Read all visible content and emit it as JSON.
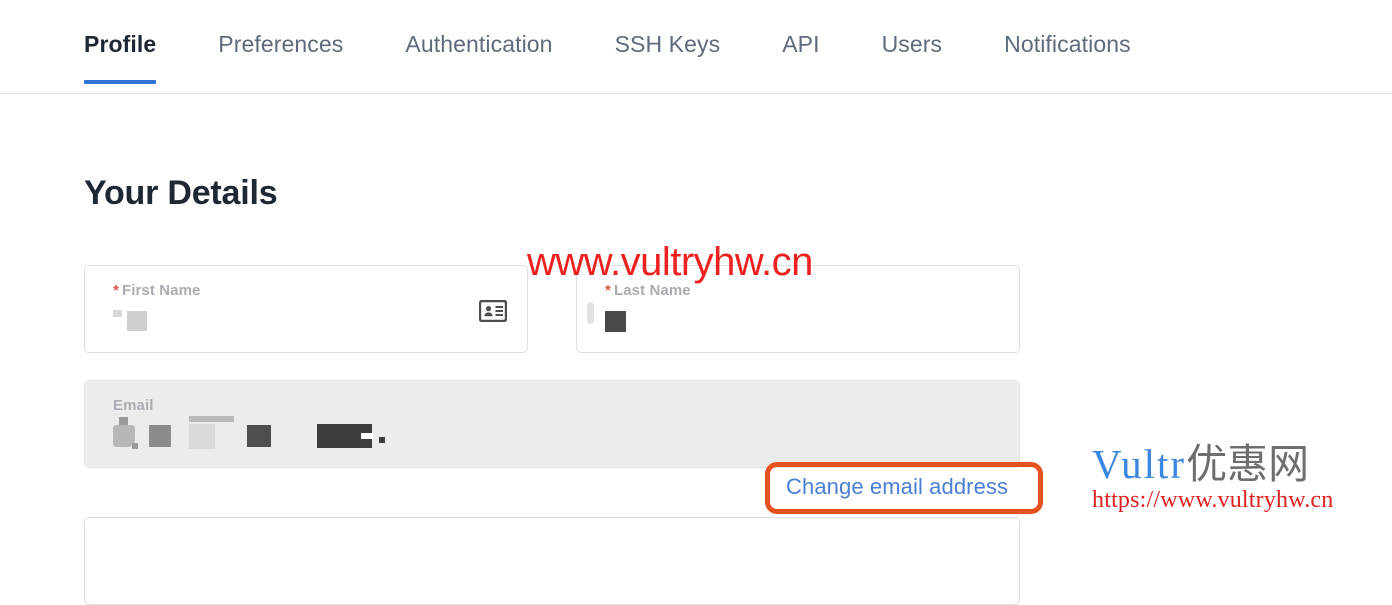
{
  "tabs": [
    {
      "label": "Profile",
      "active": true
    },
    {
      "label": "Preferences",
      "active": false
    },
    {
      "label": "Authentication",
      "active": false
    },
    {
      "label": "SSH Keys",
      "active": false
    },
    {
      "label": "API",
      "active": false
    },
    {
      "label": "Users",
      "active": false
    },
    {
      "label": "Notifications",
      "active": false
    }
  ],
  "page": {
    "title": "Your Details"
  },
  "form": {
    "first_name": {
      "label": "First Name",
      "required_marker": "*",
      "value": "",
      "redacted": true,
      "icon": "id-card-icon"
    },
    "last_name": {
      "label": "Last Name",
      "required_marker": "*",
      "value": "",
      "redacted": true
    },
    "email": {
      "label": "Email",
      "value": "",
      "redacted": true,
      "disabled": true
    },
    "change_email_link": "Change email address"
  },
  "annotation": {
    "color": "#e8521f",
    "target": "change-email-address-link"
  },
  "watermarks": {
    "top_text": "www.vultryhw.cn",
    "logo_brand": "Vultr",
    "logo_suffix": "优惠网",
    "logo_url": "https://www.vultryhw.cn"
  },
  "colors": {
    "active_tab_underline": "#3174d6",
    "active_tab_text": "#1f2733",
    "inactive_tab_text": "#5f6b7a",
    "link": "#4a7fd4",
    "required_star": "#d9534f",
    "label": "#a9adb3",
    "annotation": "#e8521f",
    "watermark_red": "#ef2020",
    "watermark_blue": "#3a86e0",
    "disabled_field_bg": "#ececec"
  }
}
